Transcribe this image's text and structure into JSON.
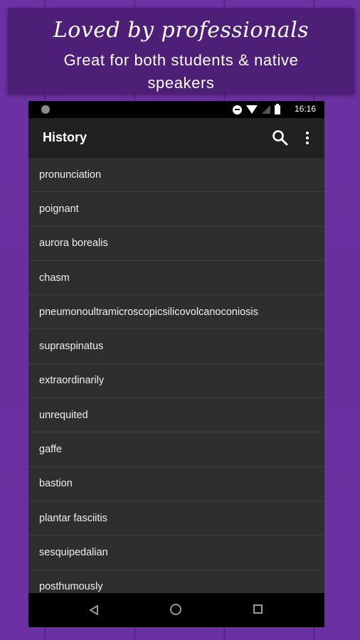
{
  "banner": {
    "title": "Loved by professionals",
    "subtitle": "Great for both students & native speakers"
  },
  "status_bar": {
    "time": "16:16",
    "icons": [
      "dnd-icon",
      "wifi-icon",
      "signal-icon",
      "battery-icon"
    ]
  },
  "app_bar": {
    "title": "History",
    "actions": [
      "search-icon",
      "overflow-menu-icon"
    ]
  },
  "history": {
    "items": [
      "pronunciation",
      "poignant",
      "aurora borealis",
      "chasm",
      "pneumonoultramicroscopicsilicovolcanoconiosis",
      "supraspinatus",
      "extraordinarily",
      "unrequited",
      "gaffe",
      "bastion",
      "plantar fasciitis",
      "sesquipedalian",
      "posthumously"
    ]
  },
  "nav_bar": {
    "buttons": [
      "back-icon",
      "home-icon",
      "recents-icon"
    ]
  },
  "colors": {
    "background": "#6a2fa0",
    "banner": "#4e1f77",
    "app_bar": "#212121",
    "list_background": "#2e2e2e"
  }
}
